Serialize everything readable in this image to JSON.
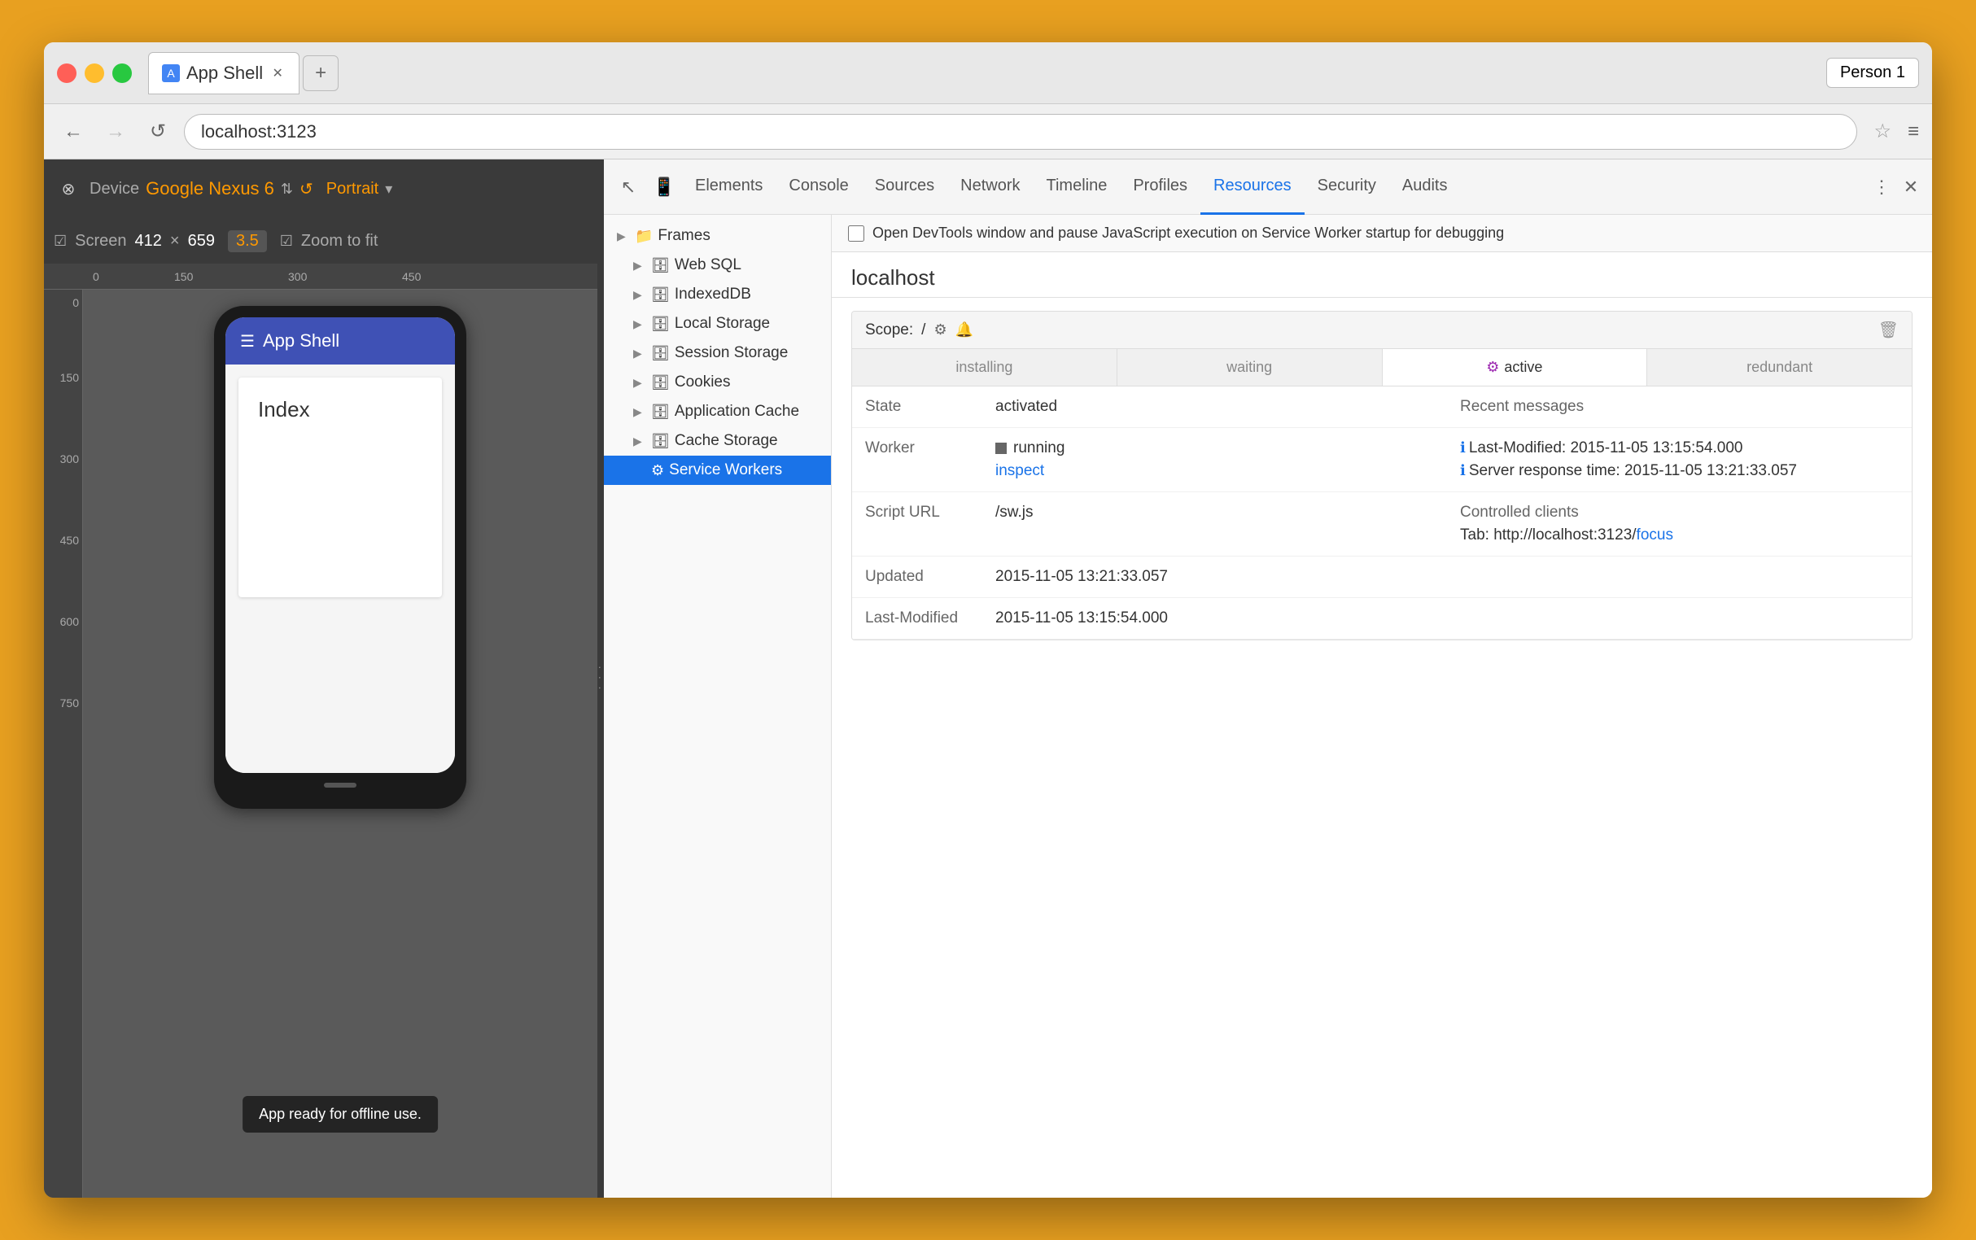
{
  "window": {
    "title": "App Shell",
    "profile": "Person 1"
  },
  "nav": {
    "url": "localhost:3123",
    "back_label": "←",
    "forward_label": "→",
    "reload_label": "↺"
  },
  "device_toolbar": {
    "device_label": "Device",
    "device_name": "Google Nexus 6",
    "portrait_label": "Portrait",
    "screen_label": "Screen",
    "width": "412",
    "x_label": "×",
    "height": "659",
    "zoom_label": "3.5",
    "zoom_to_fit_label": "Zoom to fit"
  },
  "phone": {
    "app_title": "App Shell",
    "page_heading": "Index",
    "toast_message": "App ready for offline use."
  },
  "devtools": {
    "tabs": [
      {
        "id": "elements",
        "label": "Elements"
      },
      {
        "id": "console",
        "label": "Console"
      },
      {
        "id": "sources",
        "label": "Sources"
      },
      {
        "id": "network",
        "label": "Network"
      },
      {
        "id": "timeline",
        "label": "Timeline"
      },
      {
        "id": "profiles",
        "label": "Profiles"
      },
      {
        "id": "resources",
        "label": "Resources",
        "active": true
      },
      {
        "id": "security",
        "label": "Security"
      },
      {
        "id": "audits",
        "label": "Audits"
      }
    ]
  },
  "resource_tree": {
    "items": [
      {
        "id": "frames",
        "label": "Frames",
        "icon": "📁",
        "arrow": "▶",
        "indent": 0
      },
      {
        "id": "websql",
        "label": "Web SQL",
        "icon": "🗄",
        "arrow": "▶",
        "indent": 1
      },
      {
        "id": "indexeddb",
        "label": "IndexedDB",
        "icon": "🗄",
        "arrow": "▶",
        "indent": 1
      },
      {
        "id": "local-storage",
        "label": "Local Storage",
        "icon": "🗄",
        "arrow": "▶",
        "indent": 1
      },
      {
        "id": "session-storage",
        "label": "Session Storage",
        "icon": "🗄",
        "arrow": "▶",
        "indent": 1
      },
      {
        "id": "cookies",
        "label": "Cookies",
        "icon": "🗄",
        "arrow": "▶",
        "indent": 1
      },
      {
        "id": "application-cache",
        "label": "Application Cache",
        "icon": "🗄",
        "arrow": "▶",
        "indent": 1
      },
      {
        "id": "cache-storage",
        "label": "Cache Storage",
        "icon": "🗄",
        "arrow": "▶",
        "indent": 1
      },
      {
        "id": "service-workers",
        "label": "Service Workers",
        "icon": "⚙",
        "arrow": "",
        "indent": 1,
        "selected": true
      }
    ]
  },
  "sw_panel": {
    "notice": "Open DevTools window and pause JavaScript execution on Service Worker startup for debugging",
    "host": "localhost",
    "scope_label": "Scope:",
    "scope_value": "/",
    "status_tabs": [
      {
        "id": "installing",
        "label": "installing"
      },
      {
        "id": "waiting",
        "label": "waiting"
      },
      {
        "id": "active",
        "label": "active",
        "active": true,
        "icon": "⚙"
      },
      {
        "id": "redundant",
        "label": "redundant"
      }
    ],
    "state_label": "State",
    "state_value": "activated",
    "worker_label": "Worker",
    "worker_running": "running",
    "worker_inspect": "inspect",
    "recent_messages_label": "Recent messages",
    "message1": "Last-Modified: 2015-11-05 13:15:54.000",
    "message2": "Server response time: 2015-11-05 13:21:33.057",
    "controlled_clients_label": "Controlled clients",
    "client_tab_prefix": "Tab: http://localhost:3123/",
    "client_focus": "focus",
    "script_url_label": "Script URL",
    "script_url_value": "/sw.js",
    "updated_label": "Updated",
    "updated_value": "2015-11-05 13:21:33.057",
    "last_modified_label": "Last-Modified",
    "last_modified_value": "2015-11-05 13:15:54.000"
  }
}
